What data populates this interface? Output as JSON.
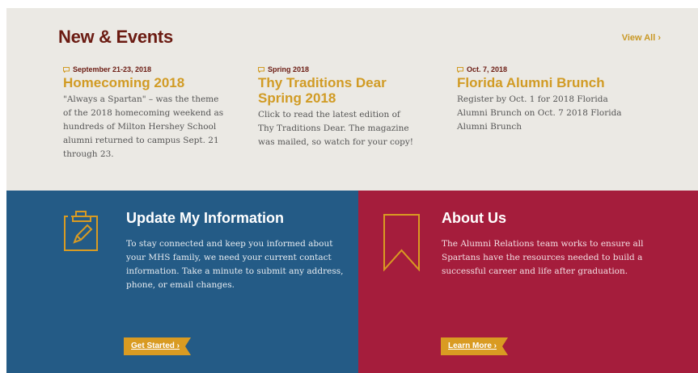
{
  "news": {
    "title": "New & Events",
    "view_all": "View All ›",
    "events": [
      {
        "date": "September 21-23, 2018",
        "title": "Homecoming 2018",
        "description": "\"Always a Spartan\" – was the theme of the 2018 homecoming weekend as hundreds of Milton Hershey School alumni returned to campus Sept. 21 through 23."
      },
      {
        "date": "Spring 2018",
        "title": "Thy Traditions Dear Spring 2018",
        "description": "Click to read the latest edition of Thy Traditions Dear. The magazine was mailed, so watch for your copy!"
      },
      {
        "date": "Oct. 7, 2018",
        "title": "Florida Alumni Brunch",
        "description": "Register by Oct. 1 for 2018 Florida Alumni Brunch on Oct. 7 2018 Florida Alumni Brunch"
      }
    ]
  },
  "update_panel": {
    "icon": "clipboard-pencil-icon",
    "title": "Update My Information",
    "description": "To stay connected and keep you informed about your MHS family, we need your current contact information. Take a minute to submit any address, phone, or email changes.",
    "button": "Get Started ›"
  },
  "about_panel": {
    "icon": "bookmark-ribbon-icon",
    "title": "About Us",
    "description": "The Alumni Relations team works to ensure all Spartans have the resources needed to build a successful career and life after graduation.",
    "button": "Learn More ›"
  },
  "colors": {
    "news_bg": "#ebe9e4",
    "heading_maroon": "#6b1b12",
    "gold": "#d19b24",
    "blue_panel": "#245b86",
    "red_panel": "#a51d3c"
  }
}
